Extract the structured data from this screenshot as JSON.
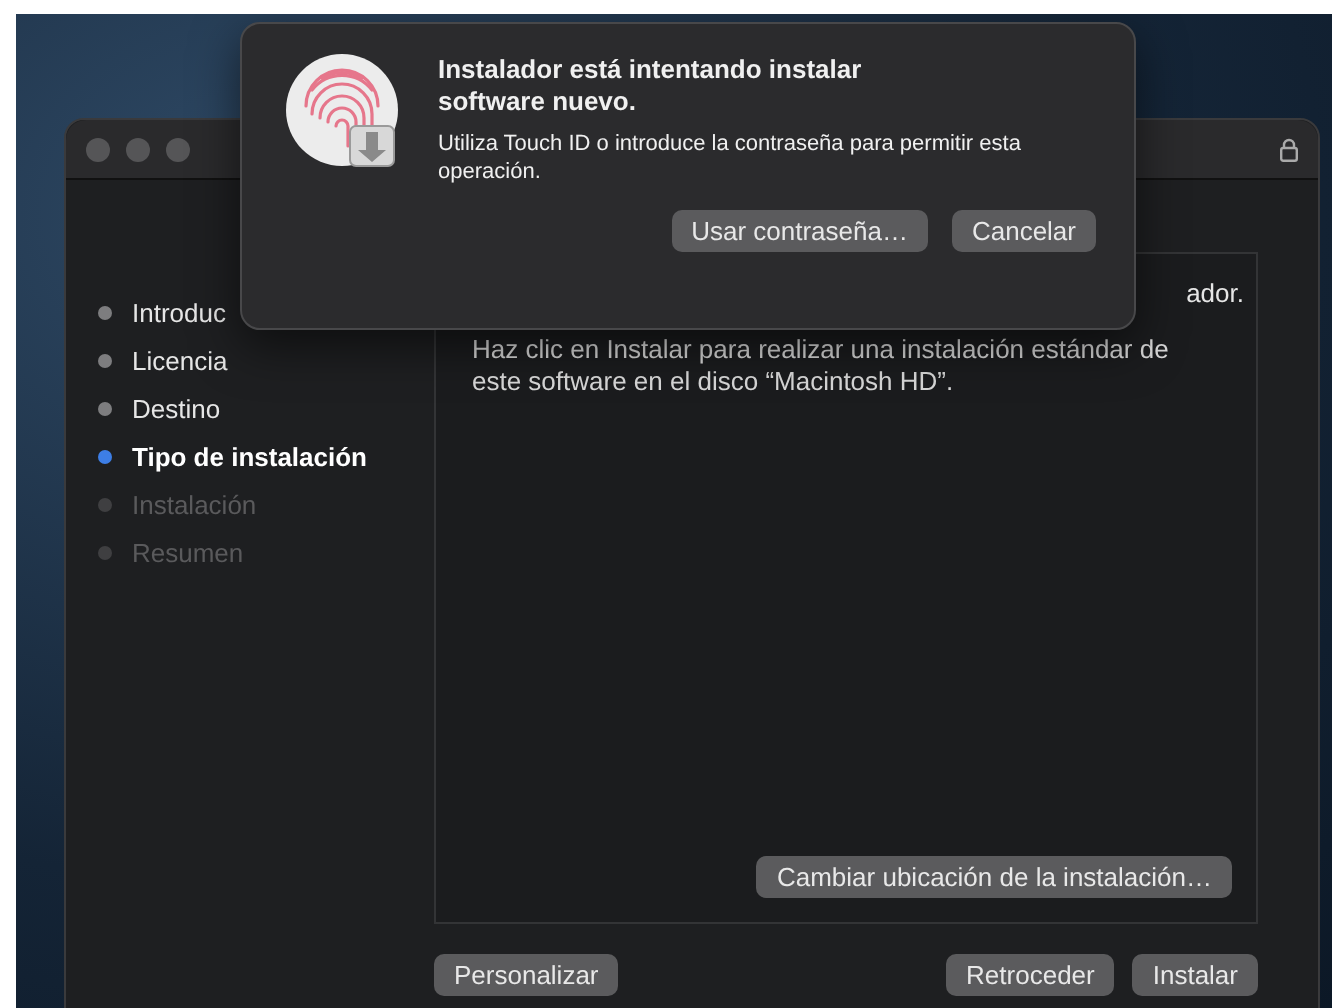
{
  "sidebar": {
    "items": [
      {
        "label": "Introduc",
        "selected": false,
        "disabled": false
      },
      {
        "label": "Licencia",
        "selected": false,
        "disabled": false
      },
      {
        "label": "Destino",
        "selected": false,
        "disabled": false
      },
      {
        "label": "Tipo de instalación",
        "selected": true,
        "disabled": false
      },
      {
        "label": "Instalación",
        "selected": false,
        "disabled": true
      },
      {
        "label": "Resumen",
        "selected": false,
        "disabled": true
      }
    ]
  },
  "content": {
    "partial_line": "ador.",
    "body": "Haz clic en Instalar para realizar una instalación estándar de este software en el disco “Macintosh HD”.",
    "change_location_button": "Cambiar ubicación de la instalación…"
  },
  "footer": {
    "customize_button": "Personalizar",
    "back_button": "Retroceder",
    "install_button": "Instalar"
  },
  "dialog": {
    "title": "Instalador está intentando instalar software nuevo.",
    "message": "Utiliza Touch ID o introduce la contraseña para permitir esta operación.",
    "buttons": [
      "Usar contraseña…",
      "Cancelar"
    ]
  }
}
